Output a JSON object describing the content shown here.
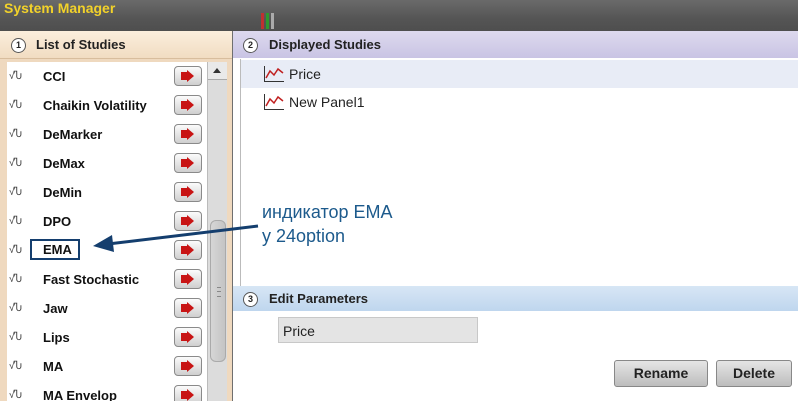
{
  "window": {
    "title": "System Manager"
  },
  "left_panel": {
    "number": "1",
    "title": "List of Studies",
    "items": [
      {
        "label": "CCI"
      },
      {
        "label": "Chaikin Volatility"
      },
      {
        "label": "DeMarker"
      },
      {
        "label": "DeMax"
      },
      {
        "label": "DeMin"
      },
      {
        "label": "DPO"
      },
      {
        "label": "EMA"
      },
      {
        "label": "Fast Stochastic"
      },
      {
        "label": "Jaw"
      },
      {
        "label": "Lips"
      },
      {
        "label": "MA"
      },
      {
        "label": "MA Envelop"
      }
    ]
  },
  "displayed_studies": {
    "number": "2",
    "title": "Displayed Studies",
    "items": [
      {
        "label": "Price"
      },
      {
        "label": "New Panel1"
      }
    ]
  },
  "edit_parameters": {
    "number": "3",
    "title": "Edit Parameters",
    "name_value": "Price",
    "rename_label": "Rename",
    "delete_label": "Delete"
  },
  "annotation": {
    "line1": "индикатор EMA",
    "line2": "у 24option"
  },
  "colors": {
    "title": "#f2d22a",
    "annotation": "#1c5a8c",
    "add_arrow": "#c81414"
  }
}
